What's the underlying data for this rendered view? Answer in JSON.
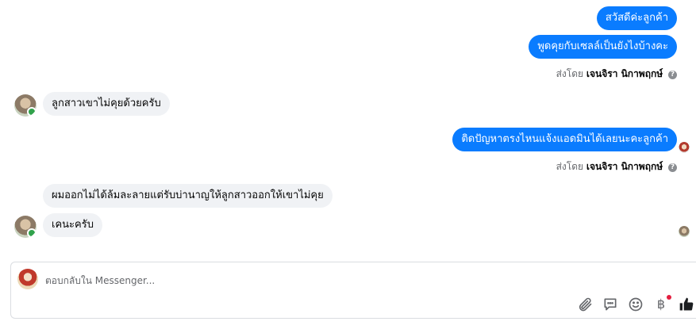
{
  "messages": {
    "m1": "สวัสดีค่ะลูกค้า",
    "m2": "พูดคุยกับเซลล์เป็นยังไงบ้างคะ",
    "m3": "ลูกสาวเขาไม่คุยด้วยครับ",
    "m4": "ติดปัญหาตรงไหนแจ้งแอดมินได้เลยนะคะลูกค้า",
    "m5": "ผมออกไม่ได้ล้มละลายแต่รับบ่านาญให้ลูกสาวออกให้เขาไม่คุย",
    "m6": "เคนะครับ"
  },
  "sent_by": {
    "prefix": "ส่งโดย",
    "name": "เจนจิรา นิกาพฤกษ์"
  },
  "composer": {
    "placeholder": "ตอบกลับใน Messenger...",
    "baht_symbol": "฿"
  },
  "colors": {
    "outgoing_bubble": "#0a7cff",
    "incoming_bubble": "#f0f2f5",
    "online_dot": "#31a24c",
    "notification_dot": "#e41e3f",
    "like_icon": "#1c1e21"
  }
}
